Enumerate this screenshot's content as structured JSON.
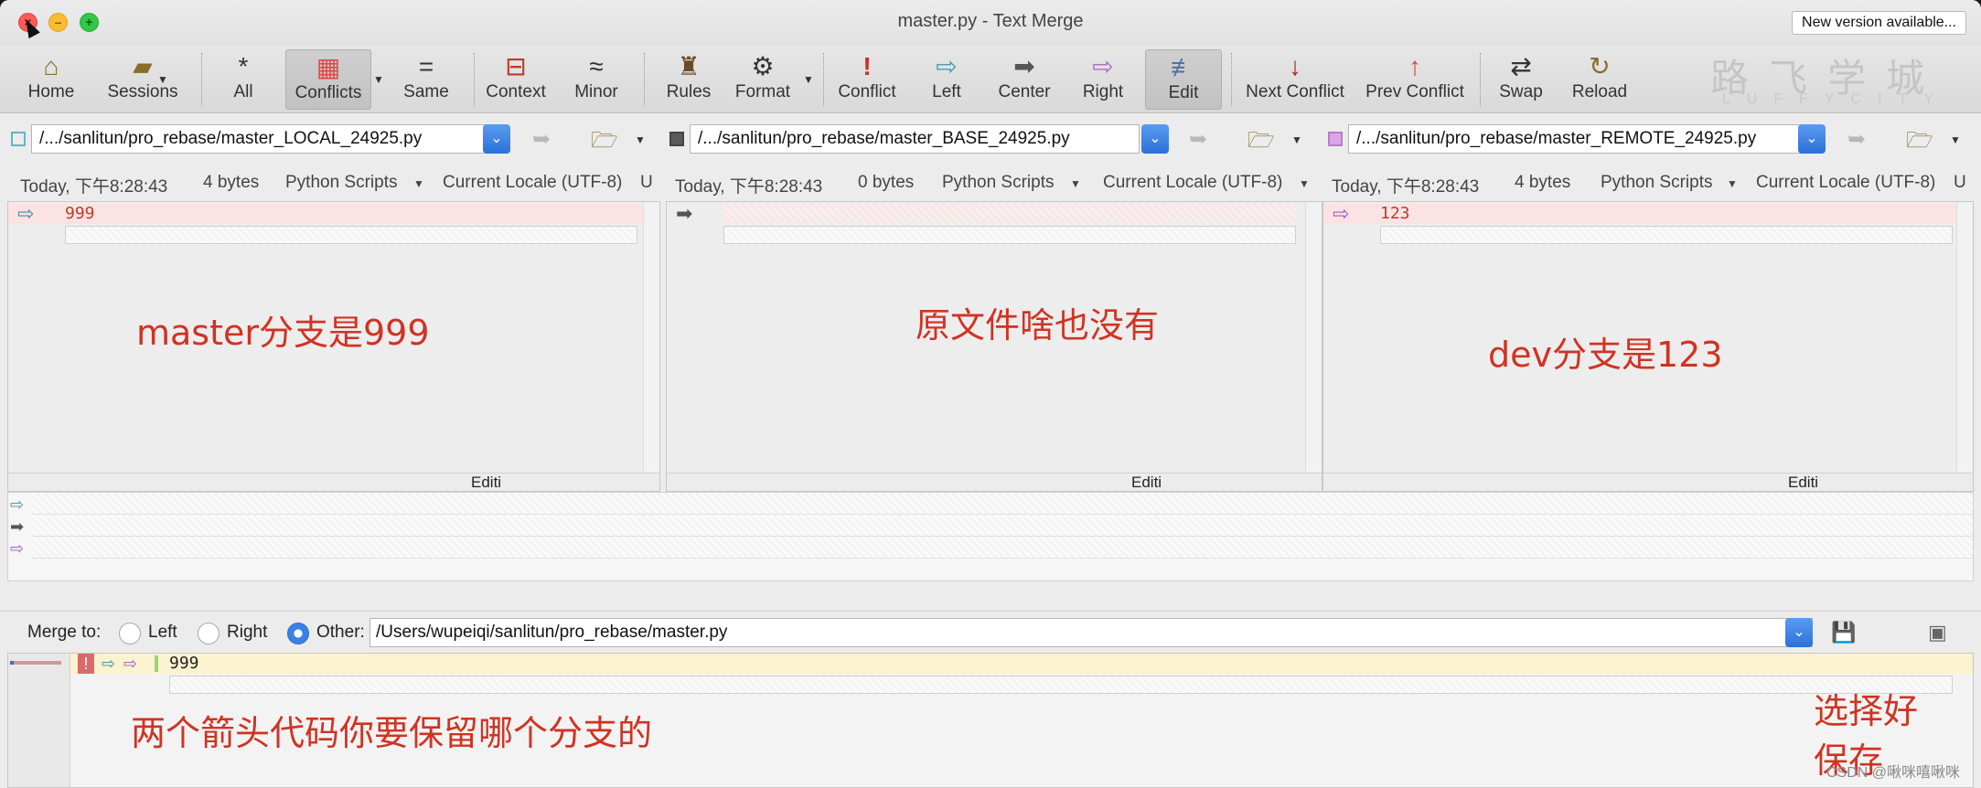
{
  "window": {
    "title": "master.py - Text Merge",
    "new_version": "New version available..."
  },
  "toolbar": {
    "home": "Home",
    "sessions": "Sessions",
    "all": "All",
    "conflicts": "Conflicts",
    "same": "Same",
    "context": "Context",
    "minor": "Minor",
    "rules": "Rules",
    "format": "Format",
    "conflict": "Conflict",
    "left": "Left",
    "center": "Center",
    "right": "Right",
    "edit": "Edit",
    "next_conflict": "Next Conflict",
    "prev_conflict": "Prev Conflict",
    "swap": "Swap",
    "reload": "Reload"
  },
  "logo": {
    "cn": "路飞学城",
    "en": "LUFFYCITY"
  },
  "panes": [
    {
      "path": "/.../sanlitun/pro_rebase/master_LOCAL_24925.py",
      "date": "Today, 下午8:28:43",
      "size": "4 bytes",
      "format": "Python Scripts",
      "encoding": "Current Locale (UTF-8)",
      "extra": "U",
      "line": "999",
      "status": "Editi",
      "swatch": "#7fd0d8",
      "arrow": "⇨",
      "arrow_color": "#4a8ea0",
      "annotation": "master分支是999"
    },
    {
      "path": "/.../sanlitun/pro_rebase/master_BASE_24925.py",
      "date": "Today, 下午8:28:43",
      "size": "0 bytes",
      "format": "Python Scripts",
      "encoding": "Current Locale (UTF-8)",
      "extra": "",
      "line": "",
      "status": "Editi",
      "swatch": "#5a5a5a",
      "arrow": "➡",
      "arrow_color": "#555555",
      "annotation": "原文件啥也没有"
    },
    {
      "path": "/.../sanlitun/pro_rebase/master_REMOTE_24925.py",
      "date": "Today, 下午8:28:43",
      "size": "4 bytes",
      "format": "Python Scripts",
      "encoding": "Current Locale (UTF-8)",
      "extra": "U",
      "line": "123",
      "status": "Editi",
      "swatch": "#cf8fe0",
      "arrow": "⇨",
      "arrow_color": "#a45cc0",
      "annotation": "dev分支是123"
    }
  ],
  "merge": {
    "label": "Merge to:",
    "left": "Left",
    "right": "Right",
    "other": "Other:",
    "path": "/Users/wupeiqi/sanlitun/pro_rebase/master.py",
    "selected": "other"
  },
  "output": {
    "line": "999",
    "annotation_main": "两个箭头代码你要保留哪个分支的",
    "annotation_side_1": "选择好",
    "annotation_side_2": "保存"
  },
  "watermark": "CSDN @啾咪嘻啾咪"
}
